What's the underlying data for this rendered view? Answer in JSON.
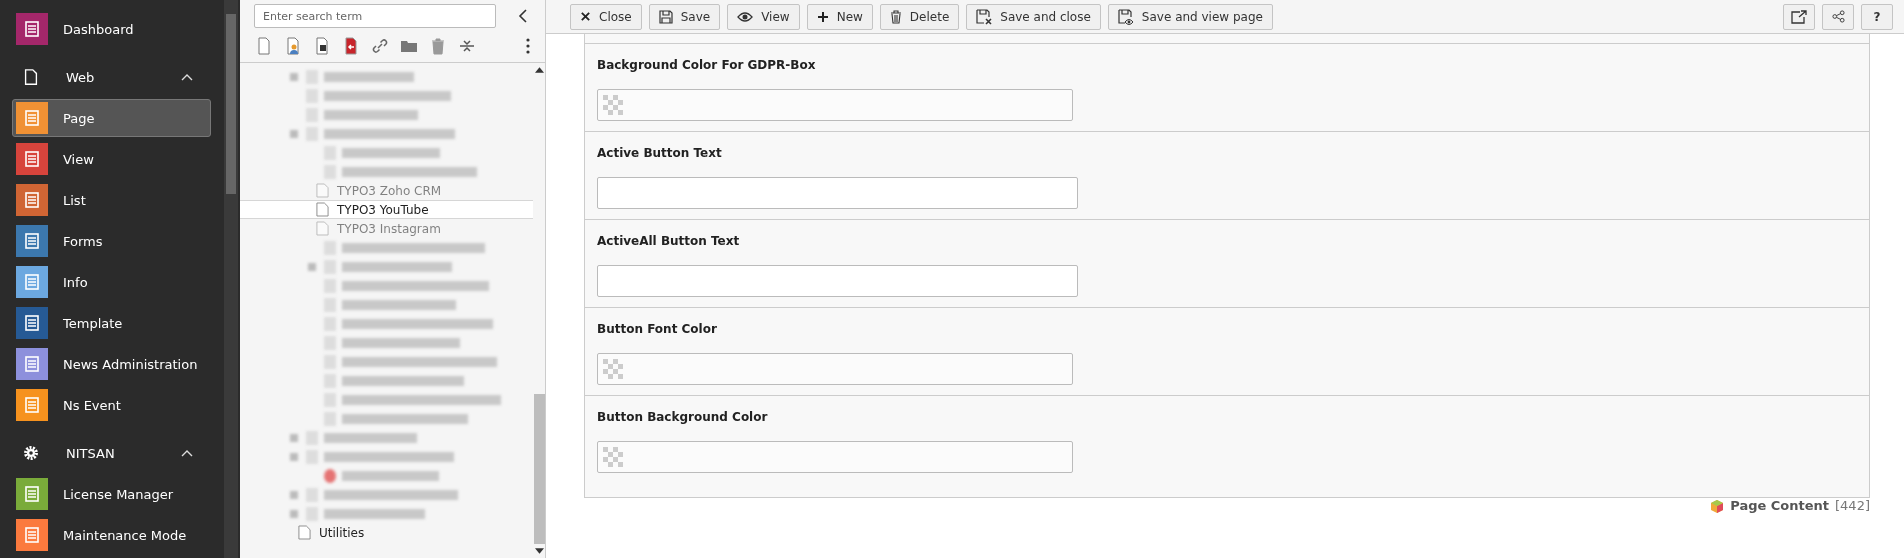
{
  "sidebar": {
    "items": [
      {
        "kind": "module",
        "label": "Dashboard",
        "color": "#a4276a",
        "selected": false
      },
      {
        "kind": "group",
        "label": "Web",
        "expanded": true,
        "children": [
          {
            "kind": "module",
            "label": "Page",
            "color": "#f09134",
            "selected": true
          },
          {
            "kind": "module",
            "label": "View",
            "color": "#d7443c",
            "selected": false
          },
          {
            "kind": "module",
            "label": "List",
            "color": "#d06534",
            "selected": false
          },
          {
            "kind": "module",
            "label": "Forms",
            "color": "#3c78ae",
            "selected": false
          },
          {
            "kind": "module",
            "label": "Info",
            "color": "#6ca8e0",
            "selected": false
          },
          {
            "kind": "module",
            "label": "Template",
            "color": "#265a95",
            "selected": false
          },
          {
            "kind": "module",
            "label": "News Administration",
            "color": "#8d90dc",
            "selected": false
          },
          {
            "kind": "module",
            "label": "Ns Event",
            "color": "#f6921e",
            "selected": false
          }
        ]
      },
      {
        "kind": "group",
        "label": "NITSAN",
        "expanded": true,
        "children": [
          {
            "kind": "module",
            "label": "License Manager",
            "color": "#7aab3a",
            "selected": false
          },
          {
            "kind": "module",
            "label": "Maintenance Mode",
            "color": "#fb7a3e",
            "selected": false
          }
        ]
      }
    ]
  },
  "tree": {
    "search": {
      "placeholder": "Enter search term"
    },
    "toolbar": [
      {
        "kind": "new-page"
      },
      {
        "kind": "user-page"
      },
      {
        "kind": "shortcut"
      },
      {
        "kind": "backend-link"
      },
      {
        "kind": "link"
      },
      {
        "kind": "folder"
      },
      {
        "kind": "trash"
      },
      {
        "kind": "spacer"
      }
    ],
    "nodes": [
      {
        "kind": "blurred",
        "expandable": true
      },
      {
        "kind": "blurred"
      },
      {
        "kind": "blurred"
      },
      {
        "kind": "blurred",
        "expandable": true,
        "children": [
          {
            "kind": "blurred"
          },
          {
            "kind": "blurred"
          },
          {
            "kind": "page",
            "label": "TYPO3 Zoho CRM",
            "selected": false,
            "faded": true
          },
          {
            "kind": "page",
            "label": "TYPO3 YouTube",
            "selected": true,
            "faded": false
          },
          {
            "kind": "page",
            "label": "TYPO3 Instagram",
            "selected": false,
            "faded": true
          },
          {
            "kind": "blurred"
          },
          {
            "kind": "blurred",
            "expandable": true
          },
          {
            "kind": "blurred"
          },
          {
            "kind": "blurred"
          },
          {
            "kind": "blurred"
          },
          {
            "kind": "blurred"
          },
          {
            "kind": "blurred"
          },
          {
            "kind": "blurred"
          },
          {
            "kind": "blurred"
          },
          {
            "kind": "blurred"
          }
        ]
      },
      {
        "kind": "blurred",
        "expandable": true
      },
      {
        "kind": "blurred",
        "expandable": true,
        "children": [
          {
            "kind": "blurred",
            "red": true
          }
        ]
      },
      {
        "kind": "blurred",
        "expandable": true
      },
      {
        "kind": "blurred",
        "expandable": true
      },
      {
        "kind": "page",
        "label": "Utilities",
        "selected": false,
        "faded": false
      }
    ]
  },
  "toolbar": {
    "buttons": [
      {
        "kind": "close",
        "label": "Close"
      },
      {
        "kind": "save",
        "label": "Save"
      },
      {
        "kind": "view",
        "label": "View"
      },
      {
        "kind": "new",
        "label": "New"
      },
      {
        "kind": "delete",
        "label": "Delete"
      },
      {
        "kind": "save-close",
        "label": "Save and close"
      },
      {
        "kind": "save-view",
        "label": "Save and view page"
      }
    ],
    "right_buttons": [
      {
        "kind": "open"
      },
      {
        "kind": "share"
      },
      {
        "kind": "help",
        "label": "?"
      }
    ]
  },
  "form": {
    "fields": [
      {
        "kind": "color",
        "label": "Background Color For GDPR-Box"
      },
      {
        "kind": "text",
        "label": "Active Button Text"
      },
      {
        "kind": "text",
        "label": "ActiveAll Button Text"
      },
      {
        "kind": "color",
        "label": "Button Font Color"
      },
      {
        "kind": "color",
        "label": "Button Background Color"
      }
    ]
  },
  "footer": {
    "record_type": "Page Content",
    "uid": "[442]"
  }
}
